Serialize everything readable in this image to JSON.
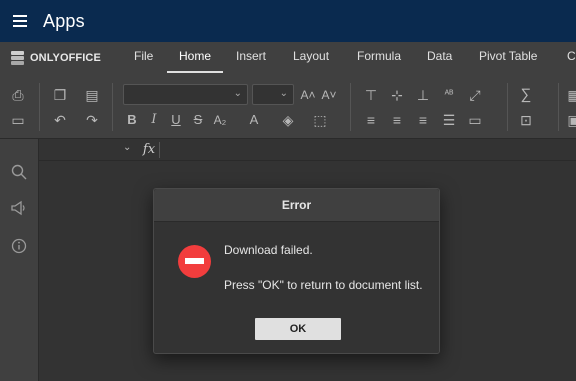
{
  "appbar": {
    "title": "Apps",
    "bg_color": "#0a2a4f"
  },
  "logo": {
    "text": "ONLYOFFICE"
  },
  "tabs": [
    {
      "label": "File"
    },
    {
      "label": "Home",
      "active": true
    },
    {
      "label": "Insert"
    },
    {
      "label": "Layout"
    },
    {
      "label": "Formula"
    },
    {
      "label": "Data"
    },
    {
      "label": "Pivot Table"
    },
    {
      "label": "C"
    }
  ],
  "formula_bar": {
    "fx_label": "fx"
  },
  "dialog": {
    "title": "Error",
    "message_line1": "Download failed.",
    "message_line2": "Press \"OK\" to return to document list.",
    "ok_label": "OK",
    "icon": "error-icon",
    "icon_color": "#f23d3d"
  }
}
